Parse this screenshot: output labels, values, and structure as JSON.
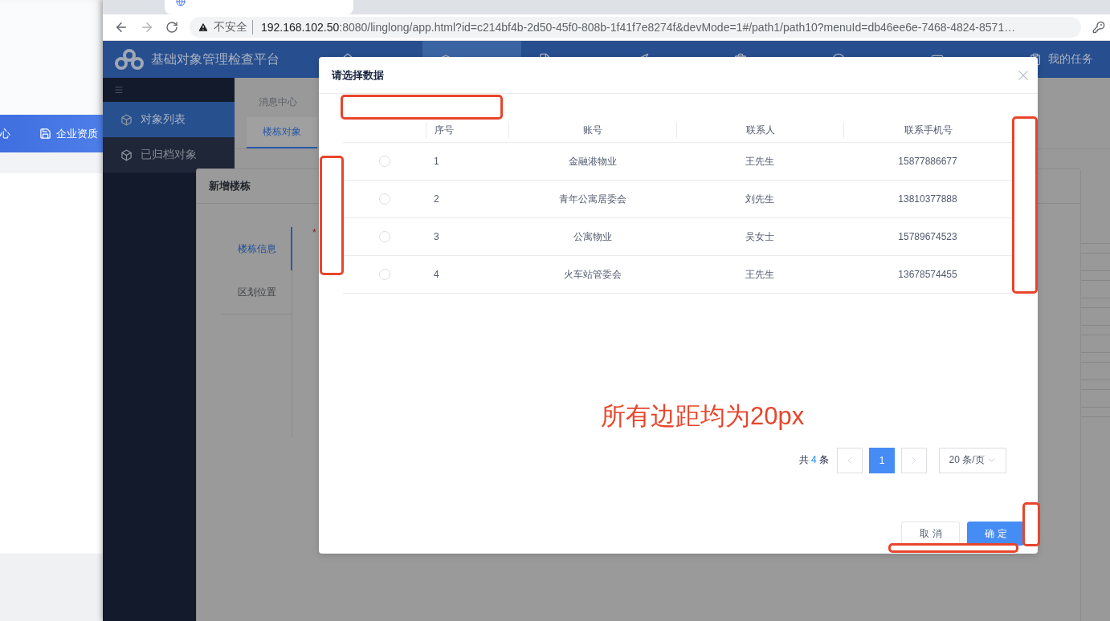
{
  "background_window": {
    "menu_items": [
      {
        "label": "心"
      },
      {
        "label": "企业资质"
      }
    ]
  },
  "browser": {
    "security_label": "不安全",
    "url_host": "192.168.102.50",
    "url_rest": ":8080/linglong/app.html?id=c214bf4b-2d50-45f0-808b-1f41f7e8274f&devMode=1#/path1/path10?menuId=db46ee6e-7468-4824-8571…"
  },
  "app": {
    "title": "基础对象管理检查平台",
    "nav": [
      {
        "selected": false
      },
      {
        "selected": true
      },
      {
        "selected": false
      },
      {
        "selected": false
      },
      {
        "selected": false
      },
      {
        "selected": false
      },
      {
        "selected": false
      },
      {
        "label": "我的任务",
        "selected": false
      }
    ],
    "sidebar": {
      "items": [
        {
          "label": "对象列表",
          "selected": true
        },
        {
          "label": "已归档对象",
          "selected": false
        }
      ]
    },
    "breadcrumb": "消息中心",
    "tabs": [
      {
        "label": "楼栋对象",
        "selected": true
      }
    ],
    "add_dialog": {
      "title": "新增楼栋",
      "required_mark": "*",
      "tabs": [
        {
          "label": "楼栋信息",
          "selected": true
        },
        {
          "label": "区划位置",
          "selected": false
        }
      ]
    }
  },
  "select_dialog": {
    "title": "请选择数据",
    "columns": [
      "序号",
      "账号",
      "联系人",
      "联系手机号"
    ],
    "rows": [
      {
        "selected": false,
        "cells": [
          "1",
          "金融港物业",
          "王先生",
          "15877886677"
        ]
      },
      {
        "selected": false,
        "cells": [
          "2",
          "青年公寓居委会",
          "刘先生",
          "13810377888"
        ]
      },
      {
        "selected": false,
        "cells": [
          "3",
          "公寓物业",
          "吴女士",
          "15789674523"
        ]
      },
      {
        "selected": false,
        "cells": [
          "4",
          "火车站管委会",
          "王先生",
          "13678574455"
        ]
      }
    ],
    "pagination": {
      "total_prefix": "共",
      "total": "4",
      "total_suffix": "条",
      "pages": [
        {
          "label": "1",
          "selected": true
        }
      ],
      "page_size": "20 条/页"
    },
    "buttons": [
      {
        "label": "取消",
        "kind": "default"
      },
      {
        "label": "确定",
        "kind": "primary"
      }
    ]
  },
  "annotation": {
    "note": "所有边距均为20px"
  }
}
